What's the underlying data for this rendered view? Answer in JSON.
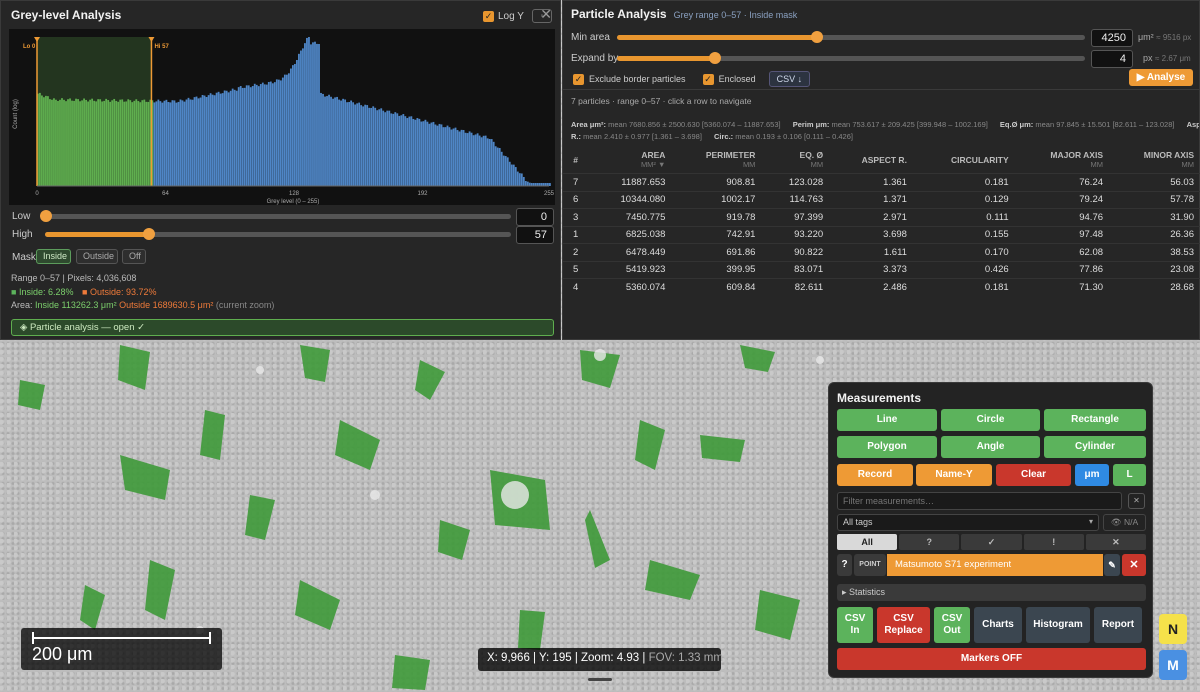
{
  "grey_panel": {
    "title": "Grey-level Analysis",
    "log_y_label": "Log Y",
    "log_y_checked": true,
    "close": "✕",
    "hist": {
      "y_label": "Count (log)",
      "x_label": "Grey level  (0 – 255)",
      "x_ticks": [
        "0",
        "64",
        "128",
        "192",
        "255"
      ],
      "lo_label": "Lo 0",
      "hi_label": "Hi 57",
      "low": 0,
      "high": 57
    },
    "low_label": "Low",
    "low_value": "0",
    "high_label": "High",
    "high_value": "57",
    "mask_label": "Mask:",
    "mask_options": [
      "Inside",
      "Outside",
      "Off"
    ],
    "range_line": "Range 0–57  |  Pixels: 4,036,608",
    "inside_pct": "Inside: 6.28%",
    "outside_pct": "Outside: 93.72%",
    "area_prefix": "Area:",
    "area_inside": "Inside 113262.3 μm²",
    "area_outside": "Outside 1689630.5 μm²",
    "area_suffix": "(current zoom)",
    "particle_btn": "◈ Particle analysis — open ✓"
  },
  "particle_panel": {
    "title": "Particle Analysis",
    "subtitle": "Grey range 0–57 · Inside mask",
    "min_area_label": "Min area",
    "min_area_value": "4250",
    "min_area_unit": "μm²",
    "min_area_px": "≈ 9516 px",
    "expand_label": "Expand by",
    "expand_value": "4",
    "expand_unit": "px",
    "expand_um": "≈ 2.67 μm",
    "exclude_label": "Exclude border particles",
    "enclosed_label": "Enclosed",
    "csv_label": "CSV ↓",
    "analyse_label": "▶ Analyse",
    "summary": "7 particles · range 0–57 · click a row to navigate",
    "stats_line1": [
      {
        "k": "Area μm²:",
        "v": "mean 7680.856 ± 2500.630",
        "r": "[5360.074 – 11887.653]"
      },
      {
        "k": "Perim μm:",
        "v": "mean 753.617 ± 209.425",
        "r": "[399.948 – 1002.169]"
      },
      {
        "k": "Eq.Ø μm:",
        "v": "mean 97.845 ± 15.501",
        "r": "[82.611 – 123.028]"
      },
      {
        "k": "Aspect",
        "v": "",
        "r": ""
      }
    ],
    "stats_line2": [
      {
        "k": "R.:",
        "v": "mean 2.410 ± 0.977",
        "r": "[1.361 – 3.698]"
      },
      {
        "k": "Circ.:",
        "v": "mean 0.193 ± 0.106",
        "r": "[0.111 – 0.426]"
      }
    ],
    "columns": [
      {
        "label": "#",
        "unit": ""
      },
      {
        "label": "AREA",
        "unit": "MM² ▼"
      },
      {
        "label": "PERIMETER",
        "unit": "MM"
      },
      {
        "label": "EQ. Ø",
        "unit": "MM"
      },
      {
        "label": "ASPECT R.",
        "unit": ""
      },
      {
        "label": "CIRCULARITY",
        "unit": ""
      },
      {
        "label": "MAJOR AXIS",
        "unit": "MM"
      },
      {
        "label": "MINOR AXIS",
        "unit": "MM"
      }
    ],
    "rows": [
      [
        "7",
        "11887.653",
        "908.81",
        "123.028",
        "1.361",
        "0.181",
        "76.24",
        "56.03"
      ],
      [
        "6",
        "10344.080",
        "1002.17",
        "114.763",
        "1.371",
        "0.129",
        "79.24",
        "57.78"
      ],
      [
        "3",
        "7450.775",
        "919.78",
        "97.399",
        "2.971",
        "0.111",
        "94.76",
        "31.90"
      ],
      [
        "1",
        "6825.038",
        "742.91",
        "93.220",
        "3.698",
        "0.155",
        "97.48",
        "26.36"
      ],
      [
        "2",
        "6478.449",
        "691.86",
        "90.822",
        "1.611",
        "0.170",
        "62.08",
        "38.53"
      ],
      [
        "5",
        "5419.923",
        "399.95",
        "83.071",
        "3.373",
        "0.426",
        "77.86",
        "23.08"
      ],
      [
        "4",
        "5360.074",
        "609.84",
        "82.611",
        "2.486",
        "0.181",
        "71.30",
        "28.68"
      ]
    ]
  },
  "measurements": {
    "title": "Measurements",
    "tools": [
      "Line",
      "Circle",
      "Rectangle",
      "Polygon",
      "Angle",
      "Cylinder"
    ],
    "record": "Record",
    "name_y": "Name-Y",
    "clear": "Clear",
    "um": "μm",
    "l": "L",
    "filter_placeholder": "Filter measurements…",
    "filter_clear": "✕",
    "tags_value": "All tags",
    "na": "N/A",
    "tag_tabs": [
      "All",
      "?",
      "✓",
      "!",
      "✕"
    ],
    "item_q": "?",
    "item_type": "POINT",
    "item_name": "Matsumoto S71 experiment",
    "item_edit": "✎",
    "item_delete": "✕",
    "statistics": "▸ Statistics",
    "actions": [
      {
        "label": "CSV\nIn",
        "color": "g"
      },
      {
        "label": "CSV\nReplace",
        "color": "r"
      },
      {
        "label": "CSV\nOut",
        "color": "g"
      },
      {
        "label": "Charts",
        "color": "dk"
      },
      {
        "label": "Histogram",
        "color": "dk"
      },
      {
        "label": "Report",
        "color": "dk"
      }
    ],
    "markers": "Markers OFF"
  },
  "scale_bar": {
    "label": "200 μm"
  },
  "status": {
    "coords": "X: 9,966 | Y: 195 | Zoom: 4.93 |",
    "fov": "FOV: 1.33 mm"
  },
  "side_buttons": {
    "n": "N",
    "m": "M"
  },
  "colors": {
    "accent": "#ee9a35",
    "inside_green": "#5cb35c",
    "outside_orange": "#ee7a3a",
    "hist_blue": "#4f86c6",
    "hist_green": "#5fae4f"
  }
}
